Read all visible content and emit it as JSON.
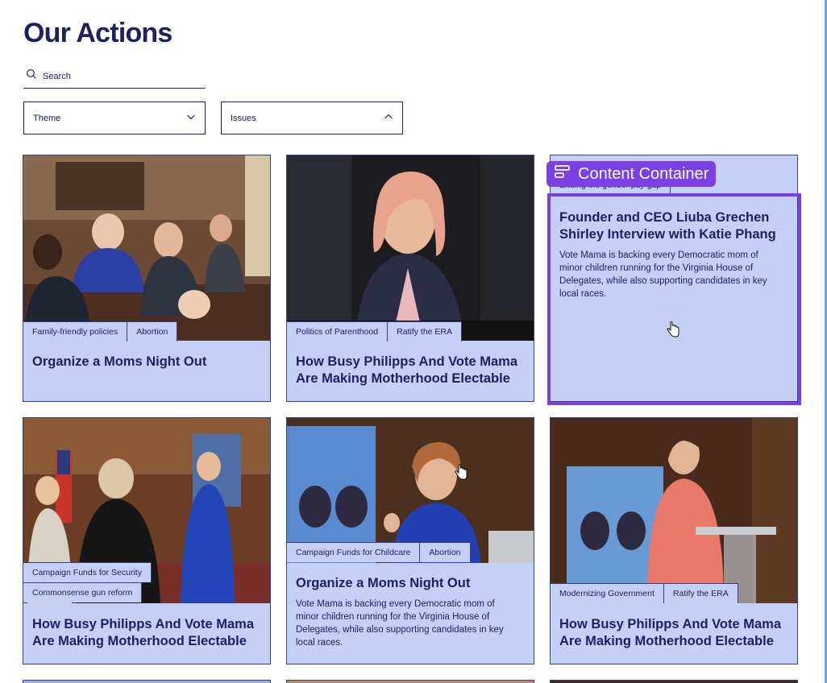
{
  "page": {
    "title": "Our Actions"
  },
  "search": {
    "placeholder": "Search"
  },
  "filters": {
    "theme_label": "Theme",
    "issues_label": "Issues"
  },
  "overlay": {
    "badge_label": "Content Container",
    "badge_icon": "container-icon"
  },
  "colors": {
    "card_bg": "#c5d0f9",
    "text": "#1d2160",
    "highlight": "#7c3fe4"
  },
  "cards": [
    {
      "tags": [
        "Family-friendly policies",
        "Abortion"
      ],
      "title": "Organize a Moms Night Out",
      "description": ""
    },
    {
      "tags": [
        "Politics of Parenthood",
        "Ratify the ERA"
      ],
      "title": "How Busy Philipps And Vote Mama Are Making Motherhood Electable",
      "description": ""
    },
    {
      "tags": [
        "Ending the gender pay gap"
      ],
      "title": "Founder and CEO Liuba Grechen Shirley Interview with Katie Phang",
      "description": "Vote Mama is backing every Democratic mom of minor children running for the Virginia House of Delegates, while also supporting candidates in key local races."
    },
    {
      "tags": [
        "Campaign Funds for Security",
        "Commonsense gun reform"
      ],
      "title": "How Busy Philipps And Vote Mama Are Making Motherhood Electable",
      "description": ""
    },
    {
      "tags": [
        "Campaign Funds for Childcare",
        "Abortion"
      ],
      "title": "Organize a Moms Night Out",
      "description": "Vote Mama is backing every Democratic mom of minor children running for the Virginia House of Delegates, while also supporting candidates in key local races."
    },
    {
      "tags": [
        "Modernizing Government",
        "Ratify the ERA"
      ],
      "title": "How Busy Philipps And Vote Mama Are Making Motherhood Electable",
      "description": ""
    }
  ]
}
